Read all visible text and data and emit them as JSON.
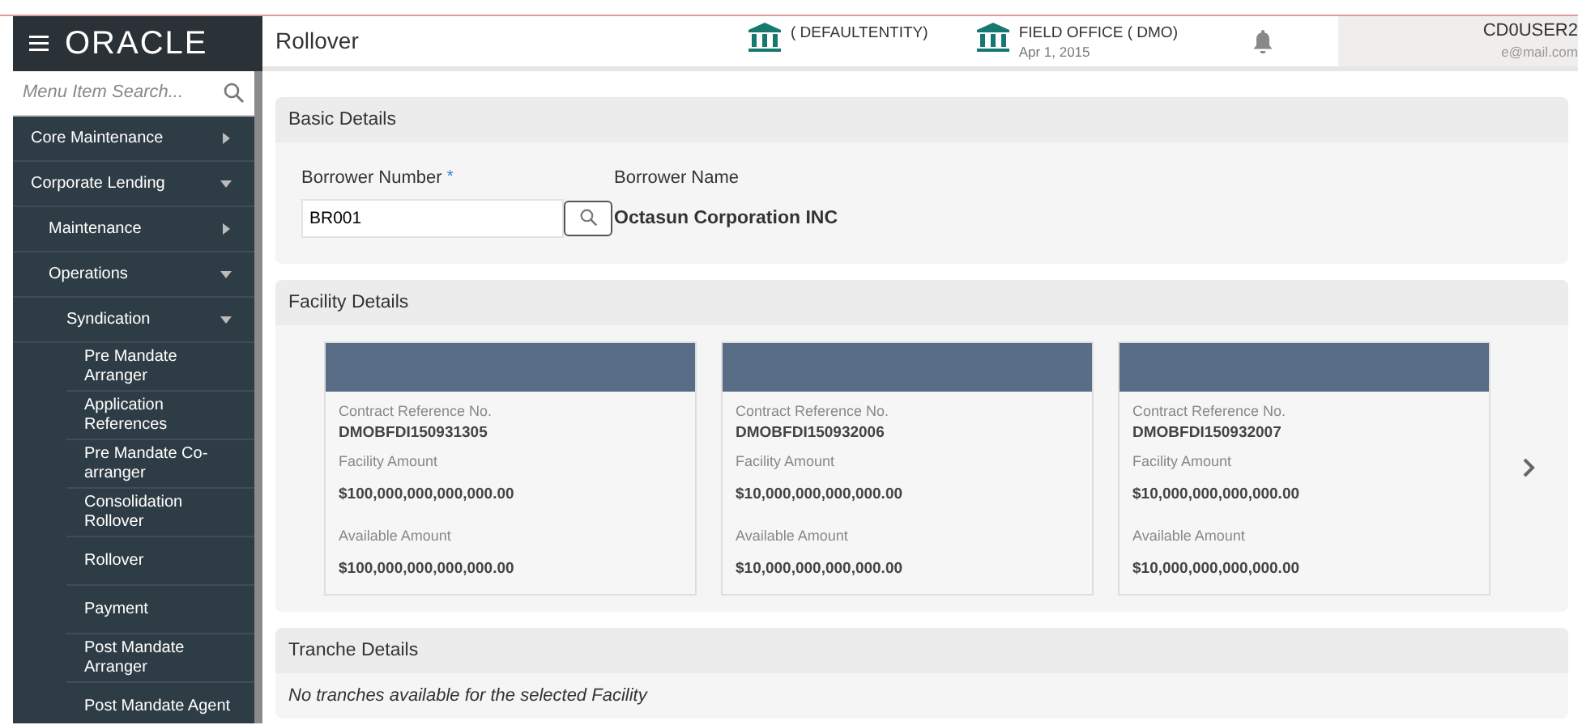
{
  "header": {
    "logo": "ORACLE",
    "title": "Rollover",
    "entities": [
      {
        "name": "( DEFAULTENTITY)"
      },
      {
        "name": "FIELD OFFICE  ( DMO)",
        "date": "Apr 1, 2015"
      }
    ],
    "user": {
      "name": "CD0USER2",
      "email": "e@mail.com"
    }
  },
  "sidebar": {
    "search": {
      "placeholder": "Menu Item Search..."
    },
    "items": [
      {
        "label": "Core Maintenance",
        "expanded": false
      },
      {
        "label": "Corporate Lending",
        "expanded": true,
        "children": [
          {
            "label": "Maintenance",
            "expanded": false
          },
          {
            "label": "Operations",
            "expanded": true,
            "children": [
              {
                "label": "Syndication",
                "expanded": true,
                "children": [
                  {
                    "label": "Pre Mandate Arranger"
                  },
                  {
                    "label": "Application References"
                  },
                  {
                    "label": "Pre Mandate Co-arranger"
                  },
                  {
                    "label": "Consolidation Rollover"
                  },
                  {
                    "label": "Rollover"
                  },
                  {
                    "label": "Payment"
                  },
                  {
                    "label": "Post Mandate Arranger"
                  },
                  {
                    "label": "Post Mandate Agent"
                  }
                ]
              }
            ]
          }
        ]
      }
    ]
  },
  "basic_details": {
    "title": "Basic Details",
    "borrower_number": {
      "label": "Borrower Number",
      "required_mark": "*",
      "value": "BR001"
    },
    "borrower_name": {
      "label": "Borrower Name",
      "value": "Octasun Corporation INC"
    }
  },
  "facility_details": {
    "title": "Facility Details",
    "cards": [
      {
        "ref_label": "Contract Reference No.",
        "ref": "DMOBFDI150931305",
        "facility_label": "Facility Amount",
        "facility_amount": "$100,000,000,000,000.00",
        "available_label": "Available Amount",
        "available_amount": "$100,000,000,000,000.00"
      },
      {
        "ref_label": "Contract Reference No.",
        "ref": "DMOBFDI150932006",
        "facility_label": "Facility Amount",
        "facility_amount": "$10,000,000,000,000.00",
        "available_label": "Available Amount",
        "available_amount": "$10,000,000,000,000.00"
      },
      {
        "ref_label": "Contract Reference No.",
        "ref": "DMOBFDI150932007",
        "facility_label": "Facility Amount",
        "facility_amount": "$10,000,000,000,000.00",
        "available_label": "Available Amount",
        "available_amount": "$10,000,000,000,000.00"
      }
    ]
  },
  "tranche_details": {
    "title": "Tranche Details",
    "message": "No tranches available for the selected Facility"
  }
}
